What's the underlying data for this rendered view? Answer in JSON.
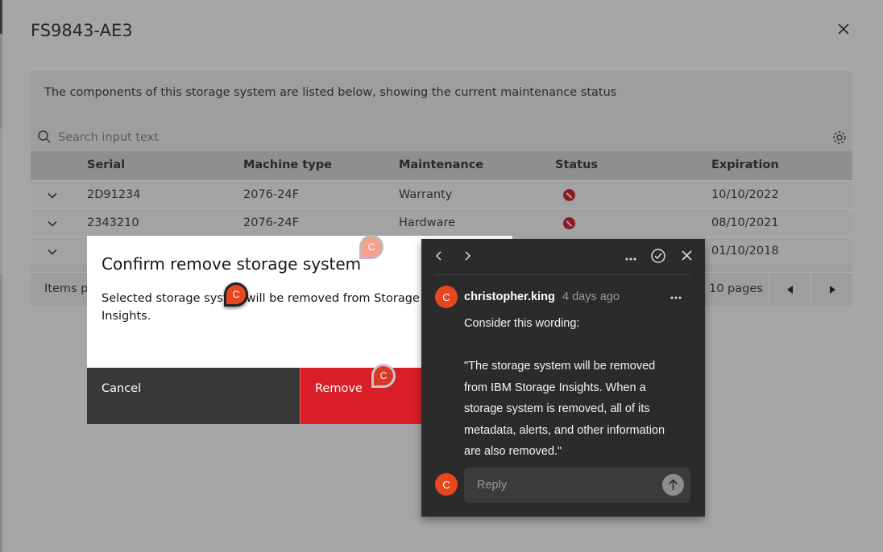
{
  "modal": {
    "title": "FS9843-AE3",
    "description": "The components of this storage system are listed below, showing the current maintenance status",
    "search_placeholder": "Search input text"
  },
  "table": {
    "headers": [
      "Serial",
      "Machine type",
      "Maintenance",
      "Status",
      "Expiration"
    ],
    "rows": [
      {
        "serial": "2D91234",
        "machine_type": "2076-24F",
        "maintenance": "Warranty",
        "status": "error",
        "expiration": "10/10/2022"
      },
      {
        "serial": "2343210",
        "machine_type": "2076-24F",
        "maintenance": "Hardware",
        "status": "error",
        "expiration": "08/10/2021"
      },
      {
        "serial": "",
        "machine_type": "",
        "maintenance": "",
        "status": "",
        "expiration": "01/10/2018"
      }
    ]
  },
  "pagination": {
    "items_label": "Items p",
    "pages_label": "10 pages"
  },
  "confirm_dialog": {
    "title": "Confirm remove storage system",
    "body": "Selected storage syst     will be removed from Storage Insights.",
    "cancel_label": "Cancel",
    "remove_label": "Remove"
  },
  "markers": [
    "C",
    "C",
    "C"
  ],
  "comment": {
    "avatar_initial": "C",
    "author": "christopher.king",
    "time": "4 days ago",
    "text": "Consider this wording:\n\n\"The storage system will be removed from IBM Storage Insights. When a storage system is removed, all of its metadata, alerts, and other information are also removed.\"",
    "reply_avatar_initial": "C",
    "reply_placeholder": "Reply"
  },
  "colors": {
    "danger": "#da1e28",
    "avatar": "#e8461f",
    "comment_bg": "#2b2b2b"
  },
  "icons": [
    "search-icon",
    "settings-icon",
    "chevron-down-icon",
    "status-error-icon",
    "close-icon",
    "caret-left-icon",
    "caret-right-icon",
    "overflow-menu-icon",
    "checkmark-circle-icon",
    "send-icon"
  ]
}
